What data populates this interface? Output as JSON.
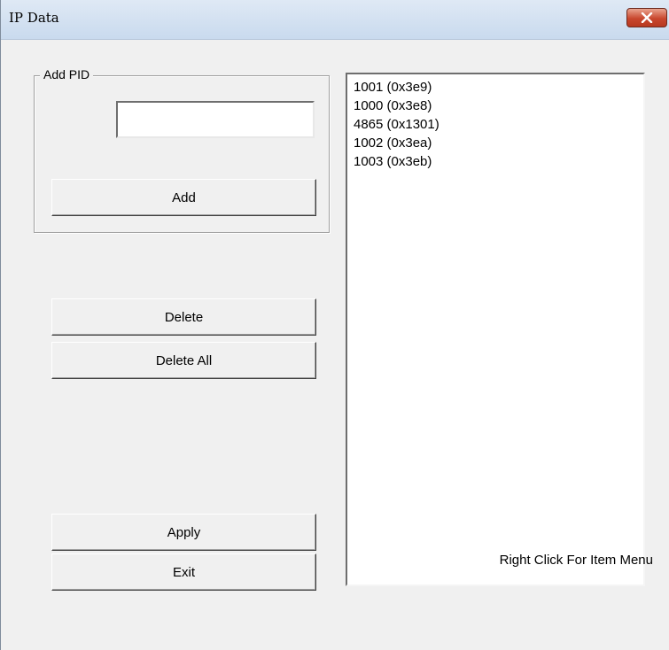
{
  "window": {
    "title": "IP Data"
  },
  "add_group": {
    "label": "Add PID",
    "input_value": "",
    "add_label": "Add"
  },
  "actions": {
    "delete_label": "Delete",
    "delete_all_label": "Delete All",
    "apply_label": "Apply",
    "exit_label": "Exit"
  },
  "pid_list": {
    "items": [
      "1001 (0x3e9)",
      "1000 (0x3e8)",
      "4865 (0x1301)",
      "1002 (0x3ea)",
      "1003 (0x3eb)"
    ]
  },
  "hint": "Right Click For Item Menu",
  "colors": {
    "close_button": "#c8472e",
    "title_bar": "#dfe9f5"
  },
  "icons": {
    "close": "close-icon"
  }
}
